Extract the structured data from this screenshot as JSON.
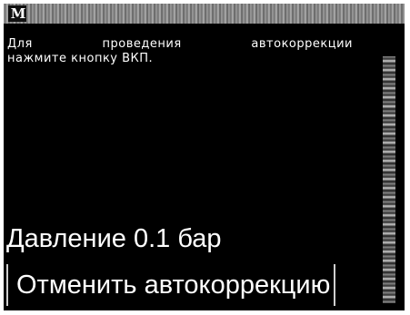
{
  "title_bar": {
    "logo_text": "M",
    "icon": "app-logo-icon"
  },
  "instruction": {
    "line1_words": [
      "Для",
      "проведения",
      "автокоррекции"
    ],
    "line2": "нажмите кнопку ВКП."
  },
  "status": {
    "pressure": "Давление 0.1 бар"
  },
  "actions": {
    "cancel_label": "Отменить автокоррекцию"
  },
  "colors": {
    "screen_background": "#000000",
    "text": "#ffffff"
  }
}
